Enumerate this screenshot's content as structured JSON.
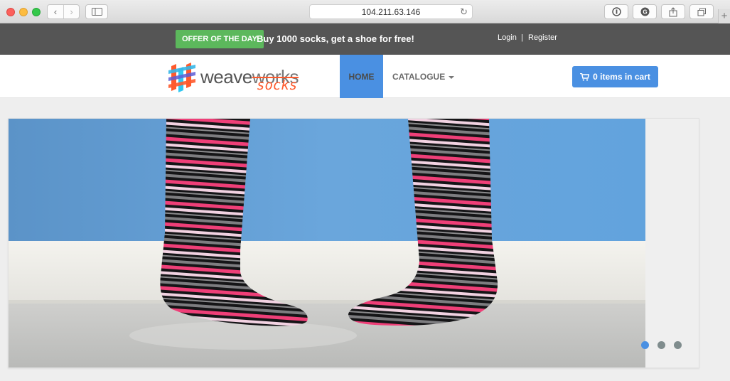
{
  "browser": {
    "url": "104.211.63.146",
    "reload_glyph": "↻",
    "back_glyph": "‹",
    "forward_glyph": "›",
    "plus_glyph": "+"
  },
  "topbar": {
    "offer_badge": "OFFER OF THE DAY",
    "offer_text": "Buy 1000 socks, get a shoe for free!",
    "login": "Login",
    "separator": "|",
    "register": "Register"
  },
  "brand": {
    "logo_text_weave": "weave",
    "logo_text_works": "works",
    "logo_text_socks": "socks"
  },
  "nav": {
    "home": "HOME",
    "catalogue": "CATALOGUE"
  },
  "cart": {
    "label": "0 items in cart"
  },
  "slider": {
    "slide_count": 3,
    "active_index": 0
  },
  "colors": {
    "accent": "#4a90e2",
    "offer_green": "#5cb85c",
    "topbar": "#555555",
    "logo_orange": "#ff5a2c"
  }
}
